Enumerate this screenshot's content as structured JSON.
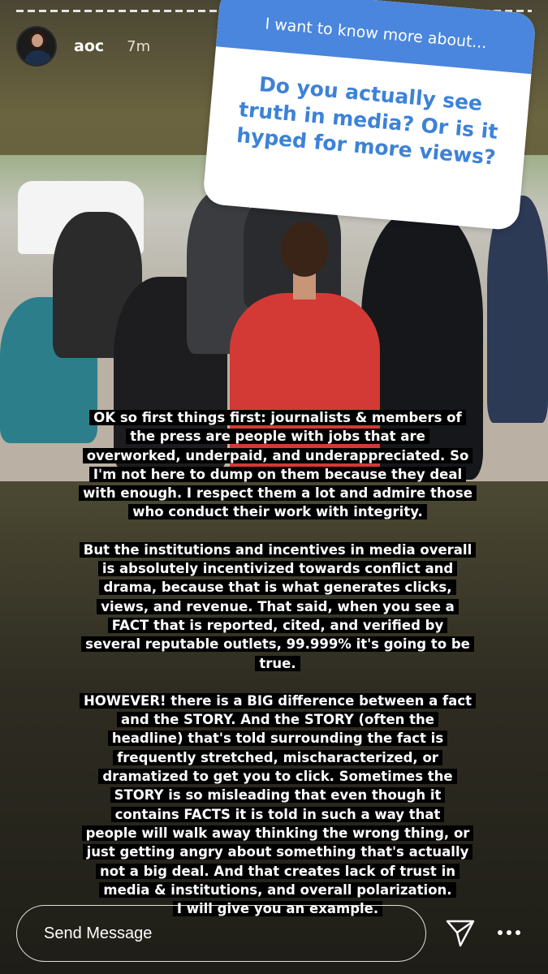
{
  "story": {
    "username": "aoc",
    "time_ago": "7m",
    "progress_segments": 45
  },
  "sticker": {
    "header": "I want to know more about...",
    "question": "Do you actually see truth in media? Or is it hyped for more views?"
  },
  "caption": {
    "paragraphs": [
      [
        "OK so first things first: journalists & members of",
        "the press are people with jobs that are",
        "overworked, underpaid, and underappreciated. So",
        "I'm not here to dump on them because they deal",
        "with enough. I respect them a lot and admire those",
        "who conduct their work with integrity."
      ],
      [
        "But the institutions and incentives in media overall",
        "is absolutely incentivized towards conflict and",
        "drama, because that is what generates clicks,",
        "views, and revenue. That said, when you see a",
        "FACT that is reported, cited, and verified by",
        "several reputable outlets, 99.999% it's going to be",
        "true."
      ],
      [
        "HOWEVER! there is a BIG difference between a fact",
        "and the STORY. And the STORY (often the",
        "headline) that's told surrounding the fact is",
        "frequently stretched, mischaracterized, or",
        "dramatized to get you to click. Sometimes the",
        "STORY is so misleading that even though it",
        "contains FACTS it is told in such a way that",
        "people will walk away thinking the wrong thing, or",
        "just getting angry about something that's actually",
        "not a big deal. And that creates lack of trust in",
        "media & institutions, and overall polarization.",
        "I will give you an example."
      ]
    ]
  },
  "footer": {
    "message_placeholder": "Send Message"
  },
  "icons": {
    "close": "close-icon",
    "send": "paper-plane-icon",
    "more": "more-dots-icon"
  }
}
